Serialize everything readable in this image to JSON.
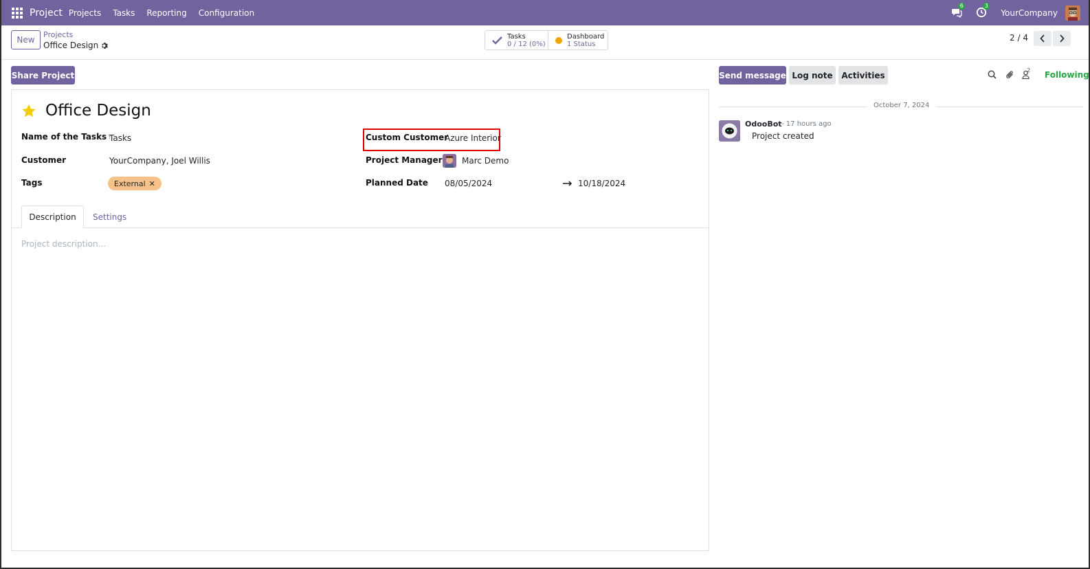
{
  "navbar": {
    "app_name": "Project",
    "menu": [
      "Projects",
      "Tasks",
      "Reporting",
      "Configuration"
    ],
    "messages_badge": "6",
    "activities_badge": "3",
    "company": "YourCompany"
  },
  "control": {
    "new_label": "New",
    "breadcrumb_parent": "Projects",
    "breadcrumb_current": "Office Design",
    "tasks_label": "Tasks",
    "tasks_value": "0 / 12 (0%)",
    "dashboard_label": "Dashboard",
    "dashboard_value": "1 Status",
    "pager": "2 / 4"
  },
  "form": {
    "share_label": "Share Project",
    "title": "Office Design",
    "name_of_tasks_label": "Name of the Tasks",
    "name_of_tasks_help": "?",
    "name_of_tasks_value": "Tasks",
    "customer_label": "Customer",
    "customer_value": "YourCompany, Joel Willis",
    "tags_label": "Tags",
    "tags": [
      "External"
    ],
    "custom_customer_label": "Custom Customer",
    "custom_customer_value": "Azure Interior",
    "project_manager_label": "Project Manager",
    "project_manager_value": "Marc Demo",
    "planned_date_label": "Planned Date",
    "planned_date_start": "08/05/2024",
    "planned_date_end": "10/18/2024",
    "tabs": [
      "Description",
      "Settings"
    ],
    "description_placeholder": "Project description..."
  },
  "chatter": {
    "send_message": "Send message",
    "log_note": "Log note",
    "activities": "Activities",
    "followers_count": "2",
    "following": "Following",
    "date": "October 7, 2024",
    "messages": [
      {
        "author": "OdooBot",
        "time": "- 17 hours ago",
        "body": "Project created"
      }
    ]
  },
  "colors": {
    "brand": "#71639e",
    "following": "#28a745",
    "star": "#f3cc00",
    "tag": "#f6c28a",
    "highlight": "#e00000"
  }
}
